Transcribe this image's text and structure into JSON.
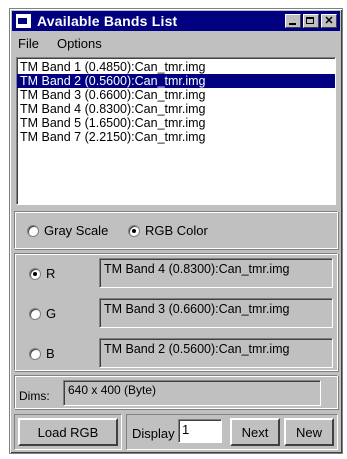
{
  "window": {
    "title": "Available Bands List"
  },
  "menu": {
    "file": "File",
    "options": "Options"
  },
  "bands": [
    {
      "label": "TM Band 1 (0.4850):Can_tmr.img",
      "selected": false
    },
    {
      "label": "TM Band 2 (0.5600):Can_tmr.img",
      "selected": true
    },
    {
      "label": "TM Band 3 (0.6600):Can_tmr.img",
      "selected": false
    },
    {
      "label": "TM Band 4 (0.8300):Can_tmr.img",
      "selected": false
    },
    {
      "label": "TM Band 5 (1.6500):Can_tmr.img",
      "selected": false
    },
    {
      "label": "TM Band 7 (2.2150):Can_tmr.img",
      "selected": false
    }
  ],
  "mode": {
    "gray_scale": "Gray Scale",
    "rgb_color": "RGB Color",
    "selected": "rgb_color"
  },
  "channels": {
    "r": {
      "label": "R",
      "band": "TM Band 4 (0.8300):Can_tmr.img",
      "selected": true
    },
    "g": {
      "label": "G",
      "band": "TM Band 3 (0.6600):Can_tmr.img",
      "selected": false
    },
    "b": {
      "label": "B",
      "band": "TM Band 2 (0.5600):Can_tmr.img",
      "selected": false
    }
  },
  "dims": {
    "label": "Dims:",
    "value": "640 x 400 (Byte)"
  },
  "buttons": {
    "load_rgb": "Load RGB",
    "display_label": "Display",
    "display_value": "1",
    "next": "Next",
    "new": "New"
  },
  "colors": {
    "title_bar": "#000080",
    "selection": "#000080",
    "face": "#c0c0c0"
  }
}
